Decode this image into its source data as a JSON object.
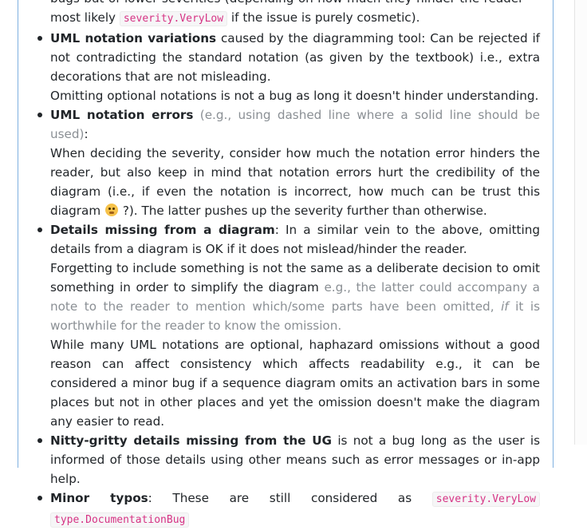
{
  "items": [
    {
      "seg1": "bugs but of lower severities (depending on how much they hinder the reader — most likely",
      "code": "severity.VeryLow",
      "seg2": "if the issue is purely cosmetic)."
    },
    {
      "title": "UML notation variations",
      "line1": "caused by the diagramming tool: Can be rejected if not contradicting the standard notation (as given by the textbook) i.e., extra decorations that are not misleading.",
      "line2": "Omitting optional notations is not a bug as long it doesn't hinder understanding."
    },
    {
      "title": "UML notation errors",
      "aside": "(e.g., using dashed line where a solid line should be used)",
      "colon": ":",
      "body1": "When deciding the severity, consider how much the notation error hinders the reader, but also keep in mind that notation errors hurt the credibility of the diagram (i.e., if even the notation is incorrect, how much can be trust this diagram",
      "emoji_name": "thinking-face",
      "body2": "?). The latter pushes up the severity further than otherwise."
    },
    {
      "title": "Details missing from a diagram",
      "line1": ": In a similar vein to the above, omitting details from a diagram is OK if it does not mislead/hinder the reader.",
      "p2a": "Forgetting to include something is not the same as a deliberate decision to omit something in order to simplify the diagram",
      "p2b": "e.g., the latter could accompany a note to the reader to mention which/some parts have been omitted,",
      "p2em": "if",
      "p2c": "it is worthwhile for the reader to know the omission.",
      "p3": "While many UML notations are optional, haphazard omissions without a good reason can affect consistency which affects readability e.g., it can be considered a minor bug if a sequence diagram omits an activation bars in some places but not in other places and yet the omission doesn't make the diagram any easier to read."
    },
    {
      "title": "Nitty-gritty details missing from the UG",
      "line1": "is not a bug long as the user is informed of those details using other means such as error messages or in-app help."
    },
    {
      "title": "Minor typos",
      "line1": ": These are still considered as",
      "code1": "severity.VeryLow",
      "code2": "type.DocumentationBug"
    }
  ],
  "colors": {
    "code": "#d63384",
    "muted": "#8a8f94",
    "panel_border": "#7fb0e0",
    "text": "#212529"
  }
}
